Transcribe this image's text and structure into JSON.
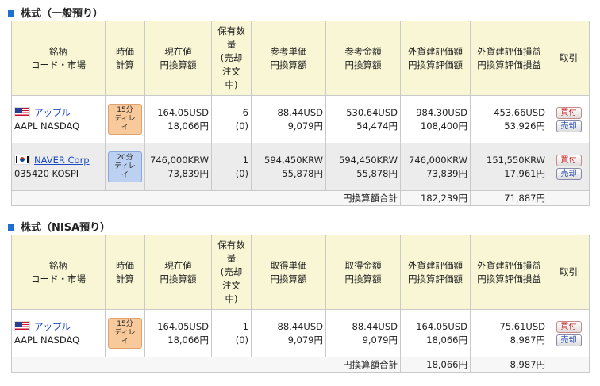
{
  "sections": [
    {
      "title": "株式（一般預り）",
      "headers": [
        "銘柄\nコード・市場",
        "時価\n計算",
        "現在値\n円換算額",
        "保有数\n量\n(売却\n注文\n中)",
        "参考単価\n円換算額",
        "参考金額\n円換算額",
        "外貨建評価額\n円換算評価額",
        "外貨建評価損益\n円換算評価損益",
        "取引"
      ],
      "rows": [
        {
          "flag": "us-flag-icon",
          "name": "アップル",
          "code": "AAPL NASDAQ",
          "delay": "15分\nディレイ",
          "price": "164.05USD",
          "price_jpy": "18,066円",
          "qty": "6",
          "qty_pending": "(0)",
          "unit": "88.44USD",
          "unit_jpy": "9,079円",
          "amount": "530.64USD",
          "amount_jpy": "54,474円",
          "valuation": "984.30USD",
          "valuation_jpy": "108,400円",
          "pnl": "453.66USD",
          "pnl_jpy": "53,926円",
          "buy_label": "買付",
          "sell_label": "売却"
        },
        {
          "flag": "kr-flag-icon",
          "name": "NAVER Corp",
          "code": "035420 KOSPI",
          "delay": "20分\nディレイ",
          "price": "746,000KRW",
          "price_jpy": "73,839円",
          "qty": "1",
          "qty_pending": "(0)",
          "unit": "594,450KRW",
          "unit_jpy": "55,878円",
          "amount": "594,450KRW",
          "amount_jpy": "55,878円",
          "valuation": "746,000KRW",
          "valuation_jpy": "73,839円",
          "pnl": "151,550KRW",
          "pnl_jpy": "17,961円",
          "buy_label": "買付",
          "sell_label": "売却"
        }
      ],
      "total_label": "円換算額合計",
      "total_valuation": "182,239円",
      "total_pnl": "71,887円"
    },
    {
      "title": "株式（NISA預り）",
      "headers": [
        "銘柄\nコード・市場",
        "時価\n計算",
        "現在値\n円換算額",
        "保有数\n量\n(売却\n注文\n中)",
        "取得単価\n円換算額",
        "取得金額\n円換算額",
        "外貨建評価額\n円換算評価額",
        "外貨建評価損益\n円換算評価損益",
        "取引"
      ],
      "rows": [
        {
          "flag": "us-flag-icon",
          "name": "アップル",
          "code": "AAPL NASDAQ",
          "delay": "15分\nディレイ",
          "price": "164.05USD",
          "price_jpy": "18,066円",
          "qty": "1",
          "qty_pending": "(0)",
          "unit": "88.44USD",
          "unit_jpy": "9,079円",
          "amount": "88.44USD",
          "amount_jpy": "9,079円",
          "valuation": "164.05USD",
          "valuation_jpy": "18,066円",
          "pnl": "75.61USD",
          "pnl_jpy": "8,987円",
          "buy_label": "買付",
          "sell_label": "売却"
        }
      ],
      "total_label": "円換算額合計",
      "total_valuation": "18,066円",
      "total_pnl": "8,987円"
    }
  ]
}
